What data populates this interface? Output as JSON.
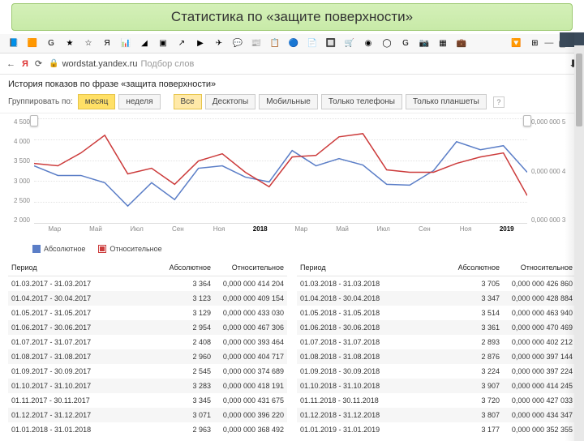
{
  "banner": {
    "title": "Статистика по «защите поверхности»"
  },
  "bookmarks": [
    "📘",
    "🟧",
    "G",
    "★",
    "☆",
    "Я",
    "📊",
    "◢",
    "▣",
    "↗",
    "▶",
    "✈",
    "💬",
    "📰",
    "📋",
    "🔵",
    "📄",
    "🔲",
    "🛒",
    "◉",
    "◯",
    "G",
    "📷",
    "▦",
    "💼",
    "🔽"
  ],
  "addr": {
    "back": "←",
    "ya": "Я",
    "lock": "🔒",
    "host": "wordstat.yandex.ru",
    "path": "Подбор слов",
    "download": "⬇"
  },
  "window": {
    "min": "—",
    "max": "▢",
    "close": "✕"
  },
  "history": {
    "title": "История показов по фразе «защита поверхности»"
  },
  "controls": {
    "group_label": "Группировать по:",
    "g1": "месяц",
    "g2": "неделя",
    "f_all": "Все",
    "f_desk": "Десктопы",
    "f_mob": "Мобильные",
    "f_phone": "Только телефоны",
    "f_tab": "Только планшеты",
    "help": "?"
  },
  "chart_data": {
    "type": "line",
    "x": [
      "Мар",
      "Май",
      "Июл",
      "Сен",
      "Ноя",
      "2018",
      "Мар",
      "Май",
      "Июл",
      "Сен",
      "Ноя",
      "2019"
    ],
    "y_left_ticks": [
      "4 500",
      "4 000",
      "3 500",
      "3 000",
      "2 500",
      "2 000"
    ],
    "y_right_ticks": [
      "0,000 000 5",
      "0,000 000 4",
      "0,000 000 3"
    ],
    "ylim_left": [
      2000,
      4500
    ],
    "series": [
      {
        "name": "Абсолютное",
        "color": "#5b7ec7",
        "values": [
          3364,
          3123,
          3129,
          2954,
          2408,
          2960,
          2545,
          3283,
          3345,
          3071,
          2963,
          3705,
          3347,
          3514,
          3361,
          2893,
          2876,
          3224,
          3907,
          3720,
          3807,
          3177
        ]
      },
      {
        "name": "Относительное",
        "color": "#cc3b3b",
        "values": [
          4.14e-07,
          4.09e-07,
          4.33e-07,
          4.67e-07,
          3.93e-07,
          4.05e-07,
          3.75e-07,
          4.18e-07,
          4.32e-07,
          3.96e-07,
          3.68e-07,
          4.27e-07,
          4.29e-07,
          4.64e-07,
          4.7e-07,
          4.02e-07,
          3.97e-07,
          3.97e-07,
          4.14e-07,
          4.27e-07,
          4.34e-07,
          3.52e-07
        ]
      }
    ],
    "legend": [
      "Абсолютное",
      "Относительное"
    ]
  },
  "table": {
    "headers": {
      "period": "Период",
      "abs": "Абсолютное",
      "rel": "Относительное"
    },
    "left": [
      {
        "p": "01.03.2017 - 31.03.2017",
        "a": "3 364",
        "r": "0,000 000 414 204"
      },
      {
        "p": "01.04.2017 - 30.04.2017",
        "a": "3 123",
        "r": "0,000 000 409 154"
      },
      {
        "p": "01.05.2017 - 31.05.2017",
        "a": "3 129",
        "r": "0,000 000 433 030"
      },
      {
        "p": "01.06.2017 - 30.06.2017",
        "a": "2 954",
        "r": "0,000 000 467 306"
      },
      {
        "p": "01.07.2017 - 31.07.2017",
        "a": "2 408",
        "r": "0,000 000 393 464"
      },
      {
        "p": "01.08.2017 - 31.08.2017",
        "a": "2 960",
        "r": "0,000 000 404 717"
      },
      {
        "p": "01.09.2017 - 30.09.2017",
        "a": "2 545",
        "r": "0,000 000 374 689"
      },
      {
        "p": "01.10.2017 - 31.10.2017",
        "a": "3 283",
        "r": "0,000 000 418 191"
      },
      {
        "p": "01.11.2017 - 30.11.2017",
        "a": "3 345",
        "r": "0,000 000 431 675"
      },
      {
        "p": "01.12.2017 - 31.12.2017",
        "a": "3 071",
        "r": "0,000 000 396 220"
      },
      {
        "p": "01.01.2018 - 31.01.2018",
        "a": "2 963",
        "r": "0,000 000 368 492"
      }
    ],
    "right": [
      {
        "p": "01.03.2018 - 31.03.2018",
        "a": "3 705",
        "r": "0,000 000 426 860"
      },
      {
        "p": "01.04.2018 - 30.04.2018",
        "a": "3 347",
        "r": "0,000 000 428 884"
      },
      {
        "p": "01.05.2018 - 31.05.2018",
        "a": "3 514",
        "r": "0,000 000 463 940"
      },
      {
        "p": "01.06.2018 - 30.06.2018",
        "a": "3 361",
        "r": "0,000 000 470 469"
      },
      {
        "p": "01.07.2018 - 31.07.2018",
        "a": "2 893",
        "r": "0,000 000 402 212"
      },
      {
        "p": "01.08.2018 - 31.08.2018",
        "a": "2 876",
        "r": "0,000 000 397 144"
      },
      {
        "p": "01.09.2018 - 30.09.2018",
        "a": "3 224",
        "r": "0,000 000 397 224"
      },
      {
        "p": "01.10.2018 - 31.10.2018",
        "a": "3 907",
        "r": "0,000 000 414 245"
      },
      {
        "p": "01.11.2018 - 30.11.2018",
        "a": "3 720",
        "r": "0,000 000 427 033"
      },
      {
        "p": "01.12.2018 - 31.12.2018",
        "a": "3 807",
        "r": "0,000 000 434 347"
      },
      {
        "p": "01.01.2019 - 31.01.2019",
        "a": "3 177",
        "r": "0,000 000 352 355"
      }
    ]
  }
}
